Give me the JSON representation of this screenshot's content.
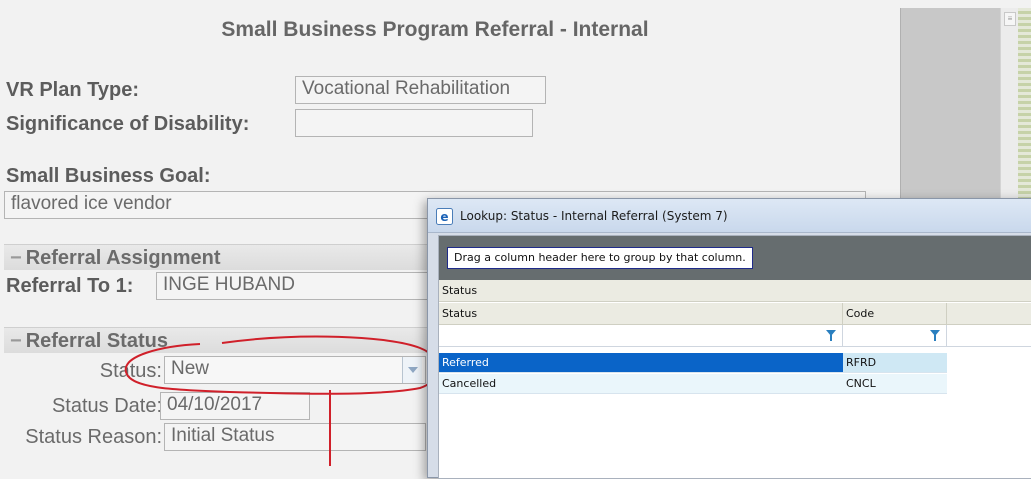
{
  "form": {
    "title": "Small Business Program Referral - Internal",
    "vr_plan_type_label": "VR Plan Type:",
    "vr_plan_type_value": "Vocational Rehabilitation",
    "significance_label": "Significance of Disability:",
    "significance_value": "",
    "goal_label": "Small Business Goal:",
    "goal_value": "flavored ice vendor",
    "assignment_section": "Referral Assignment",
    "referral_to_label": "Referral To 1:",
    "referral_to_value": "INGE HUBAND",
    "status_section": "Referral Status",
    "status_label": "Status:",
    "status_value": "New",
    "status_date_label": "Status Date:",
    "status_date_value": "04/10/2017",
    "status_reason_label": "Status Reason:",
    "status_reason_value": "Initial Status",
    "collapse_glyph": "−"
  },
  "lookup": {
    "title": "Lookup: Status - Internal Referral (System 7)",
    "group_hint": "Drag a column header here to group by that column.",
    "band_label": "Status",
    "columns": [
      "Status",
      "Code"
    ],
    "rows": [
      {
        "status": "Referred",
        "code": "RFRD",
        "selected": true
      },
      {
        "status": "Cancelled",
        "code": "CNCL",
        "selected": false
      }
    ]
  },
  "colors": {
    "selection": "#0a64c8",
    "annotation": "#d0202a"
  },
  "icons": {
    "popup_icon": "ie-browser-icon",
    "filter": "filter-funnel-icon",
    "collapse": "collapse-minus-icon",
    "dropdown": "chevron-down-icon"
  }
}
